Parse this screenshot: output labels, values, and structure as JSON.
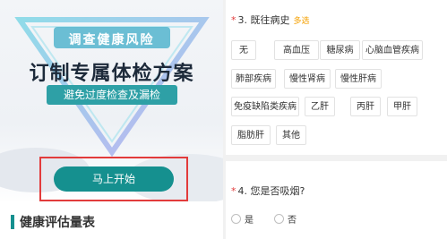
{
  "banner": {
    "top_label": "调查健康风险",
    "title": "订制专属体检方案",
    "subtitle": "避免过度检查及漏检",
    "start_button": "马上开始",
    "section_title": "健康评估量表"
  },
  "question3": {
    "required_mark": "*",
    "title": "3. 既往病史",
    "badge": "多选",
    "options": [
      "无",
      "高血压",
      "糖尿病",
      "心脑血管疾病",
      "肺部疾病",
      "慢性肾病",
      "慢性肝病",
      "免疫缺陷类疾病",
      "乙肝",
      "丙肝",
      "甲肝",
      "脂肪肝",
      "其他"
    ]
  },
  "question4": {
    "required_mark": "*",
    "title": "4. 您是否吸烟?",
    "options": [
      "是",
      "否"
    ]
  },
  "colors": {
    "teal": "#15908f",
    "required": "#e23b3b",
    "badge": "#f5a000"
  }
}
